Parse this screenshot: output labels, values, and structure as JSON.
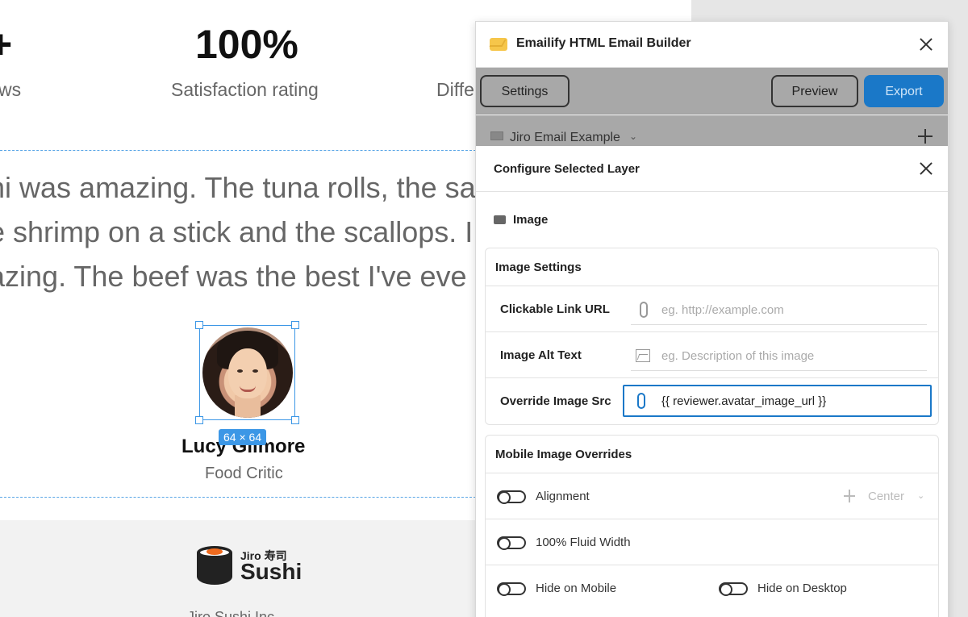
{
  "canvas": {
    "stats": [
      {
        "value": "+",
        "label": "ws"
      },
      {
        "value": "100%",
        "label": "Satisfaction rating"
      },
      {
        "value": "",
        "label": "Diffe"
      }
    ],
    "quote_lines": [
      "hi was amazing. The tuna rolls, the sa",
      "e shrimp on a stick and the scallops. I",
      "azing. The beef was the best I've eve"
    ],
    "avatar_size_badge": "64 × 64",
    "reviewer": {
      "name": "Lucy Gilmore",
      "title": "Food Critic"
    },
    "footer": {
      "logo_sub": "Jiro 寿司",
      "logo_main": "Sushi",
      "cut_text": "Jiro Sushi Inc"
    }
  },
  "panel": {
    "app_title": "Emailify HTML Email Builder",
    "toolbar": {
      "settings_label": "Settings",
      "preview_label": "Preview",
      "export_label": "Export"
    },
    "project": {
      "name": "Jiro Email Example"
    },
    "config": {
      "title": "Configure Selected Layer",
      "layer_type": "Image"
    },
    "image_settings": {
      "heading": "Image Settings",
      "link_url": {
        "label": "Clickable Link URL",
        "placeholder": "eg. http://example.com"
      },
      "alt_text": {
        "label": "Image Alt Text",
        "placeholder": "eg. Description of this image"
      },
      "override_src": {
        "label": "Override Image Src",
        "value": "{{ reviewer.avatar_image_url }}"
      }
    },
    "mobile_overrides": {
      "heading": "Mobile Image Overrides",
      "alignment": {
        "label": "Alignment",
        "value": "Center"
      },
      "fluid_width": {
        "label": "100% Fluid Width"
      },
      "hide_mobile": {
        "label": "Hide on Mobile"
      },
      "hide_desktop": {
        "label": "Hide on Desktop"
      }
    }
  },
  "colors": {
    "accent": "#1a78c8",
    "selection": "#3c97e6",
    "toolbar_overlay": "#a8a8a8",
    "logo_orange": "#f06b1f"
  }
}
